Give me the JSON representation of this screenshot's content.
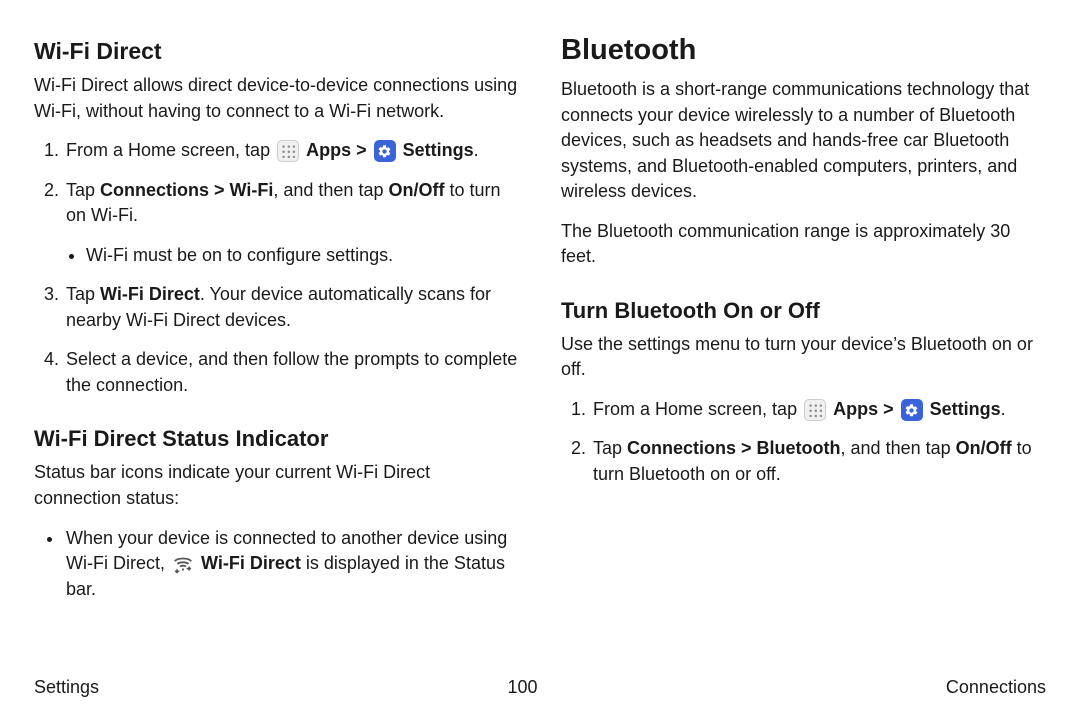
{
  "left": {
    "h2": "Wi-Fi Direct",
    "intro": "Wi-Fi Direct allows direct device-to-device connections using Wi-Fi, without having to connect to a Wi-Fi network.",
    "step1_a": "From a Home screen, tap ",
    "step1_apps": "Apps",
    "step1_caret": " > ",
    "step1_settings": "Settings",
    "step1_end": ".",
    "step2_a": "Tap ",
    "step2_b": "Connections > Wi-Fi",
    "step2_c": ", and then tap ",
    "step2_d": "On/Off",
    "step2_e": " to turn on Wi-Fi.",
    "step2_bullet": "Wi-Fi must be on to configure settings.",
    "step3_a": "Tap ",
    "step3_b": "Wi-Fi Direct",
    "step3_c": ". Your device automatically scans for nearby Wi-Fi Direct devices.",
    "step4": "Select a device, and then follow the prompts to complete the connection.",
    "h3": "Wi-Fi Direct Status Indicator",
    "status_intro": "Status bar icons indicate your current Wi-Fi Direct connection status:",
    "status_bullet_a": "When your device is connected to another device using Wi-Fi Direct, ",
    "status_bullet_b": "Wi-Fi Direct",
    "status_bullet_c": " is displayed in the Status bar."
  },
  "right": {
    "h1": "Bluetooth",
    "intro": "Bluetooth is a short-range communications technology that connects your device wirelessly to a number of Bluetooth devices, such as headsets and hands-free car Bluetooth systems, and Bluetooth-enabled computers, printers, and wireless devices.",
    "range": "The Bluetooth communication range is approximately 30 feet.",
    "h3": "Turn Bluetooth On or Off",
    "sub_intro": "Use the settings menu to turn your device’s Bluetooth on or off.",
    "step1_a": "From a Home screen, tap ",
    "step1_apps": "Apps",
    "step1_caret": " > ",
    "step1_settings": "Settings",
    "step1_end": ".",
    "step2_a": "Tap ",
    "step2_b": "Connections > Bluetooth",
    "step2_c": ", and then tap ",
    "step2_d": "On/Off",
    "step2_e": " to turn Bluetooth on or off."
  },
  "footer": {
    "left": "Settings",
    "center": "100",
    "right": "Connections"
  }
}
